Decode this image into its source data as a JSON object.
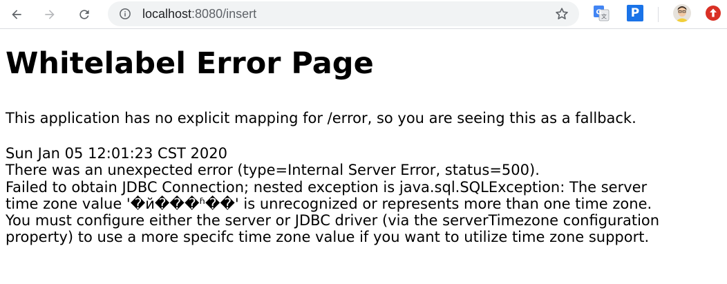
{
  "browser": {
    "url_host": "localhost",
    "url_rest": ":8080/insert",
    "icons": {
      "back": "back-arrow-icon",
      "forward": "forward-arrow-icon",
      "reload": "reload-icon",
      "info": "info-icon",
      "star": "bookmark-star-icon",
      "translate": "translate-extension-icon",
      "p_extension": "P",
      "avatar": "profile-avatar",
      "update": "update-icon"
    },
    "colors": {
      "omnibox_bg": "#f1f3f4",
      "p_extension_bg": "#1a73e8",
      "update_red": "#d93025"
    }
  },
  "page": {
    "title": "Whitelabel Error Page",
    "intro": "This application has no explicit mapping for /error, so you are seeing this as a fallback.",
    "timestamp": "Sun Jan 05 12:01:23 CST 2020",
    "error_line": "There was an unexpected error (type=Internal Server Error, status=500).",
    "message_lines": [
      "Failed to obtain JDBC Connection; nested exception is java.sql.SQLException: The server",
      "time zone value '�й���ʱ��' is unrecognized or represents more than one time zone.",
      "You must configure either the server or JDBC driver (via the serverTimezone configuration",
      "property) to use a more specifc time zone value if you want to utilize time zone support."
    ]
  }
}
